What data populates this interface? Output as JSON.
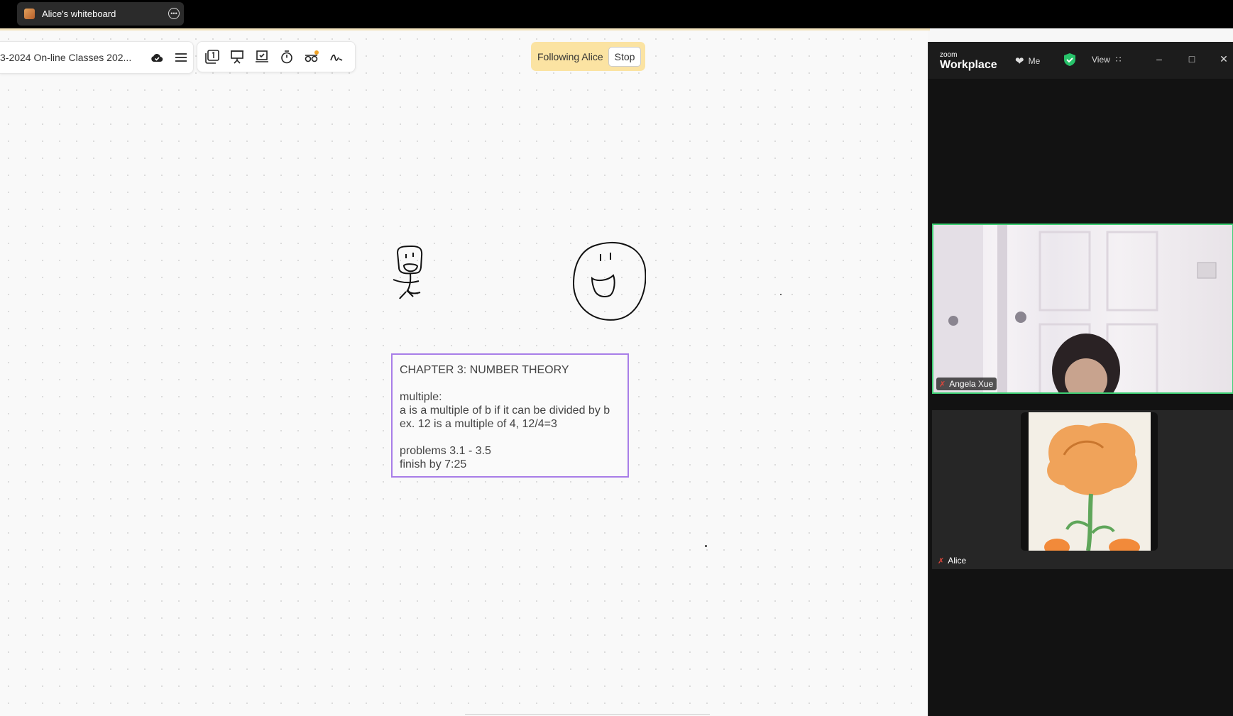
{
  "browser_tab": {
    "title": "Alice's whiteboard"
  },
  "toolbar": {
    "board_name": "3-2024 On-line Classes 202..."
  },
  "following": {
    "text": "Following Alice",
    "stop_label": "Stop"
  },
  "note": {
    "title": "CHAPTER 3: NUMBER THEORY",
    "line1": "multiple:",
    "line2": "a is a multiple of b if it can be divided by b",
    "line3": "ex. 12 is a multiple of 4, 12/4=3",
    "line4": "problems 3.1 - 3.5",
    "line5": "finish by 7:25",
    "border_color": "#a87ee8"
  },
  "zoom": {
    "logo_small": "zoom",
    "logo_large": "Workplace",
    "meeting_label": "Me",
    "view_label": "View",
    "participants": [
      {
        "name": "Angela Xue",
        "muted": true
      },
      {
        "name": "Alice",
        "muted": true
      }
    ],
    "active_speaker_color": "#3ecf74"
  },
  "colors": {
    "following_bg": "#fbe3a2",
    "topbar": "#000000"
  }
}
